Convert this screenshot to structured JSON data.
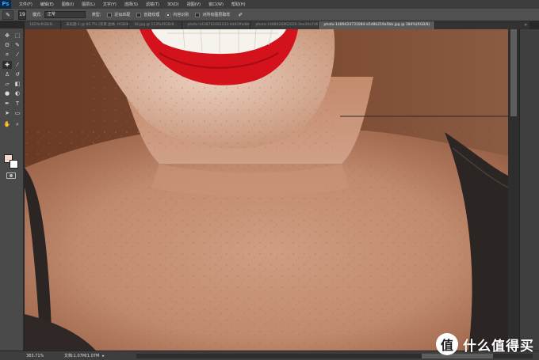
{
  "app": {
    "logo": "Ps"
  },
  "menu": [
    "文件(F)",
    "编辑(E)",
    "图像(I)",
    "图层(L)",
    "文字(Y)",
    "选择(S)",
    "滤镜(T)",
    "3D(D)",
    "视图(V)",
    "窗口(W)",
    "帮助(H)"
  ],
  "options": {
    "tool_icon": "healing-brush-icon",
    "brush_size": "19",
    "mode_label": "模式:",
    "mode_value": "正常",
    "type_label": "类型:",
    "checkboxes": [
      {
        "label": "近似匹配",
        "checked": false
      },
      {
        "label": "创建纹理",
        "checked": false
      },
      {
        "label": "内容识别",
        "checked": true
      },
      {
        "label": "对所有图层取样",
        "checked": false
      }
    ]
  },
  "tabs": [
    {
      "label": "182%(RGB/8...",
      "active": false
    },
    {
      "label": "未标题-1 @ 66.7% (背景 副本, RGB/8)",
      "active": false
    },
    {
      "label": "18.jpg @ 113%(RGB/8...",
      "active": false
    },
    {
      "label": "photo-1438761681033-6461ffad8d80 (1).jpg",
      "active": false
    },
    {
      "label": "photo-1488426862026-3ee34a7d66df.jpg",
      "active": false
    },
    {
      "label": "photo-1489424731084-a5d8b219a5bb.jpg @ 384%(RGB/8)",
      "active": true
    }
  ],
  "toolbox": {
    "tools": [
      "move-icon",
      "marquee-icon",
      "lasso-icon",
      "quick-select-icon",
      "crop-icon",
      "eyedropper-icon",
      "healing-brush-icon",
      "brush-icon",
      "clone-stamp-icon",
      "history-brush-icon",
      "eraser-icon",
      "gradient-icon",
      "blur-icon",
      "dodge-icon",
      "pen-icon",
      "type-icon",
      "path-select-icon",
      "shape-icon",
      "hand-icon",
      "zoom-icon"
    ],
    "foreground": "#f6d8cf",
    "background": "#ffffff"
  },
  "status": {
    "zoom": "383.71%",
    "doc_info": "文档:1.07M/1.07M",
    "arrow": "▸"
  },
  "watermark": {
    "logo": "值",
    "text": "什么值得买"
  },
  "colors": {
    "lipstick": "#d3121c",
    "skin": "#c8957a",
    "strap": "#2b2524",
    "background_wall": "#7a452e"
  }
}
